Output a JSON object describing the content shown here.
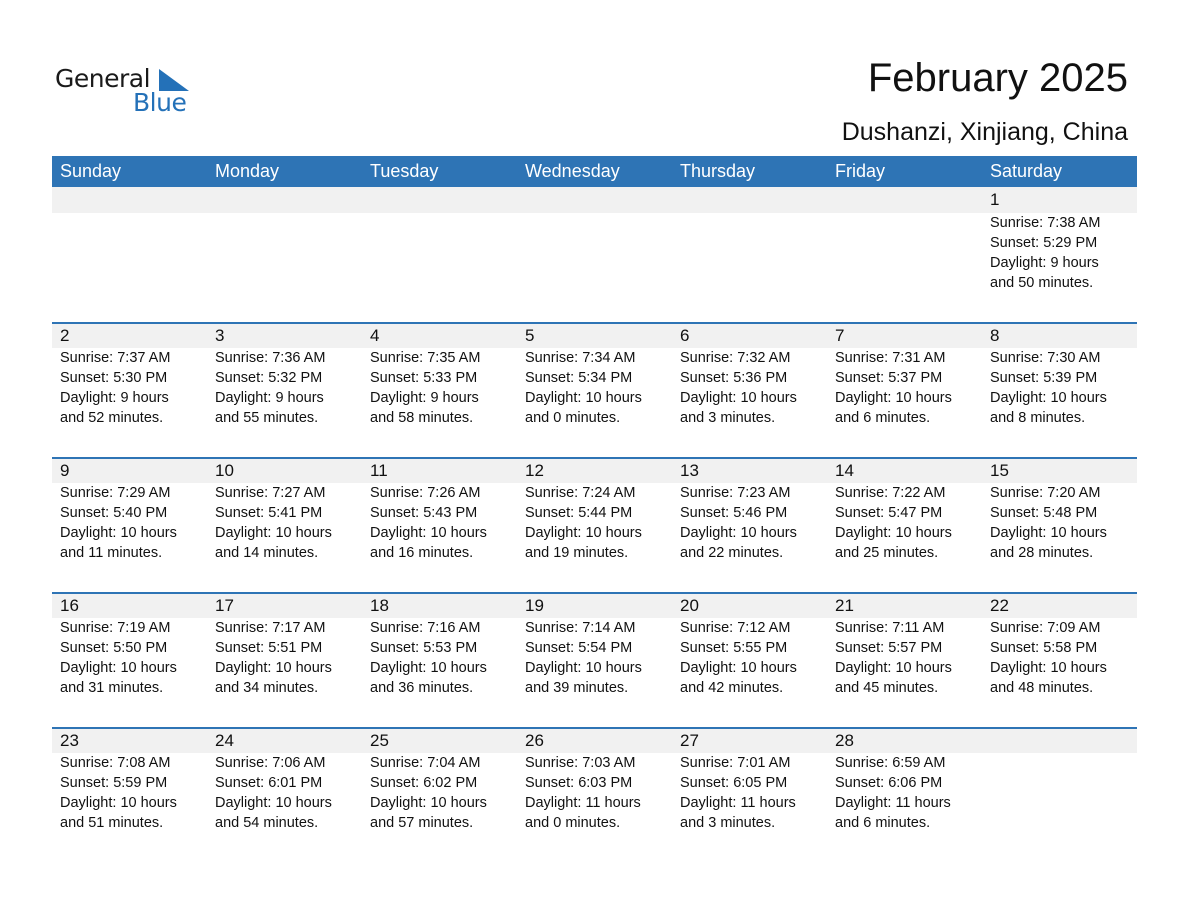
{
  "logo": {
    "line1": "General",
    "line2": "Blue"
  },
  "title": "February 2025",
  "location": "Dushanzi, Xinjiang, China",
  "colors": {
    "accent": "#2e74b5",
    "row_band": "#f1f1f1",
    "logo_blue": "#2471b8"
  },
  "weekdays": [
    "Sunday",
    "Monday",
    "Tuesday",
    "Wednesday",
    "Thursday",
    "Friday",
    "Saturday"
  ],
  "weeks": [
    [
      null,
      null,
      null,
      null,
      null,
      null,
      {
        "day": "1",
        "sunrise": "Sunrise: 7:38 AM",
        "sunset": "Sunset: 5:29 PM",
        "daylight1": "Daylight: 9 hours",
        "daylight2": "and 50 minutes."
      }
    ],
    [
      {
        "day": "2",
        "sunrise": "Sunrise: 7:37 AM",
        "sunset": "Sunset: 5:30 PM",
        "daylight1": "Daylight: 9 hours",
        "daylight2": "and 52 minutes."
      },
      {
        "day": "3",
        "sunrise": "Sunrise: 7:36 AM",
        "sunset": "Sunset: 5:32 PM",
        "daylight1": "Daylight: 9 hours",
        "daylight2": "and 55 minutes."
      },
      {
        "day": "4",
        "sunrise": "Sunrise: 7:35 AM",
        "sunset": "Sunset: 5:33 PM",
        "daylight1": "Daylight: 9 hours",
        "daylight2": "and 58 minutes."
      },
      {
        "day": "5",
        "sunrise": "Sunrise: 7:34 AM",
        "sunset": "Sunset: 5:34 PM",
        "daylight1": "Daylight: 10 hours",
        "daylight2": "and 0 minutes."
      },
      {
        "day": "6",
        "sunrise": "Sunrise: 7:32 AM",
        "sunset": "Sunset: 5:36 PM",
        "daylight1": "Daylight: 10 hours",
        "daylight2": "and 3 minutes."
      },
      {
        "day": "7",
        "sunrise": "Sunrise: 7:31 AM",
        "sunset": "Sunset: 5:37 PM",
        "daylight1": "Daylight: 10 hours",
        "daylight2": "and 6 minutes."
      },
      {
        "day": "8",
        "sunrise": "Sunrise: 7:30 AM",
        "sunset": "Sunset: 5:39 PM",
        "daylight1": "Daylight: 10 hours",
        "daylight2": "and 8 minutes."
      }
    ],
    [
      {
        "day": "9",
        "sunrise": "Sunrise: 7:29 AM",
        "sunset": "Sunset: 5:40 PM",
        "daylight1": "Daylight: 10 hours",
        "daylight2": "and 11 minutes."
      },
      {
        "day": "10",
        "sunrise": "Sunrise: 7:27 AM",
        "sunset": "Sunset: 5:41 PM",
        "daylight1": "Daylight: 10 hours",
        "daylight2": "and 14 minutes."
      },
      {
        "day": "11",
        "sunrise": "Sunrise: 7:26 AM",
        "sunset": "Sunset: 5:43 PM",
        "daylight1": "Daylight: 10 hours",
        "daylight2": "and 16 minutes."
      },
      {
        "day": "12",
        "sunrise": "Sunrise: 7:24 AM",
        "sunset": "Sunset: 5:44 PM",
        "daylight1": "Daylight: 10 hours",
        "daylight2": "and 19 minutes."
      },
      {
        "day": "13",
        "sunrise": "Sunrise: 7:23 AM",
        "sunset": "Sunset: 5:46 PM",
        "daylight1": "Daylight: 10 hours",
        "daylight2": "and 22 minutes."
      },
      {
        "day": "14",
        "sunrise": "Sunrise: 7:22 AM",
        "sunset": "Sunset: 5:47 PM",
        "daylight1": "Daylight: 10 hours",
        "daylight2": "and 25 minutes."
      },
      {
        "day": "15",
        "sunrise": "Sunrise: 7:20 AM",
        "sunset": "Sunset: 5:48 PM",
        "daylight1": "Daylight: 10 hours",
        "daylight2": "and 28 minutes."
      }
    ],
    [
      {
        "day": "16",
        "sunrise": "Sunrise: 7:19 AM",
        "sunset": "Sunset: 5:50 PM",
        "daylight1": "Daylight: 10 hours",
        "daylight2": "and 31 minutes."
      },
      {
        "day": "17",
        "sunrise": "Sunrise: 7:17 AM",
        "sunset": "Sunset: 5:51 PM",
        "daylight1": "Daylight: 10 hours",
        "daylight2": "and 34 minutes."
      },
      {
        "day": "18",
        "sunrise": "Sunrise: 7:16 AM",
        "sunset": "Sunset: 5:53 PM",
        "daylight1": "Daylight: 10 hours",
        "daylight2": "and 36 minutes."
      },
      {
        "day": "19",
        "sunrise": "Sunrise: 7:14 AM",
        "sunset": "Sunset: 5:54 PM",
        "daylight1": "Daylight: 10 hours",
        "daylight2": "and 39 minutes."
      },
      {
        "day": "20",
        "sunrise": "Sunrise: 7:12 AM",
        "sunset": "Sunset: 5:55 PM",
        "daylight1": "Daylight: 10 hours",
        "daylight2": "and 42 minutes."
      },
      {
        "day": "21",
        "sunrise": "Sunrise: 7:11 AM",
        "sunset": "Sunset: 5:57 PM",
        "daylight1": "Daylight: 10 hours",
        "daylight2": "and 45 minutes."
      },
      {
        "day": "22",
        "sunrise": "Sunrise: 7:09 AM",
        "sunset": "Sunset: 5:58 PM",
        "daylight1": "Daylight: 10 hours",
        "daylight2": "and 48 minutes."
      }
    ],
    [
      {
        "day": "23",
        "sunrise": "Sunrise: 7:08 AM",
        "sunset": "Sunset: 5:59 PM",
        "daylight1": "Daylight: 10 hours",
        "daylight2": "and 51 minutes."
      },
      {
        "day": "24",
        "sunrise": "Sunrise: 7:06 AM",
        "sunset": "Sunset: 6:01 PM",
        "daylight1": "Daylight: 10 hours",
        "daylight2": "and 54 minutes."
      },
      {
        "day": "25",
        "sunrise": "Sunrise: 7:04 AM",
        "sunset": "Sunset: 6:02 PM",
        "daylight1": "Daylight: 10 hours",
        "daylight2": "and 57 minutes."
      },
      {
        "day": "26",
        "sunrise": "Sunrise: 7:03 AM",
        "sunset": "Sunset: 6:03 PM",
        "daylight1": "Daylight: 11 hours",
        "daylight2": "and 0 minutes."
      },
      {
        "day": "27",
        "sunrise": "Sunrise: 7:01 AM",
        "sunset": "Sunset: 6:05 PM",
        "daylight1": "Daylight: 11 hours",
        "daylight2": "and 3 minutes."
      },
      {
        "day": "28",
        "sunrise": "Sunrise: 6:59 AM",
        "sunset": "Sunset: 6:06 PM",
        "daylight1": "Daylight: 11 hours",
        "daylight2": "and 6 minutes."
      },
      null
    ]
  ]
}
